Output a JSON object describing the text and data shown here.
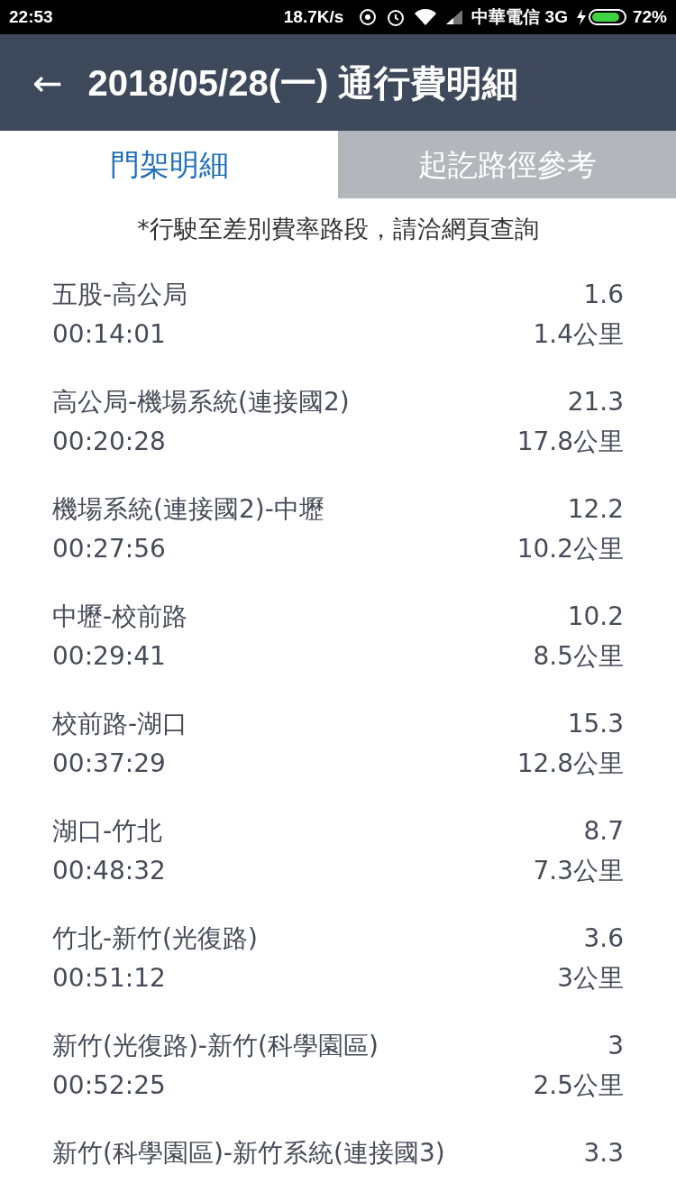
{
  "status_bar": {
    "time": "22:53",
    "speed": "18.7K/s",
    "carrier": "中華電信 3G",
    "battery": "72%"
  },
  "header": {
    "back": "←",
    "title": "2018/05/28(一) 通行費明細"
  },
  "tabs": [
    {
      "label": "門架明細",
      "selected": true
    },
    {
      "label": "起訖路徑參考",
      "selected": false
    }
  ],
  "notice": "*行駛至差別費率路段，請洽網頁查詢",
  "segments": [
    {
      "route": "五股-高公局",
      "amount": "1.6",
      "time": "00:14:01",
      "distance": "1.4公里"
    },
    {
      "route": "高公局-機場系統(連接國2)",
      "amount": "21.3",
      "time": "00:20:28",
      "distance": "17.8公里"
    },
    {
      "route": "機場系統(連接國2)-中壢",
      "amount": "12.2",
      "time": "00:27:56",
      "distance": "10.2公里"
    },
    {
      "route": "中壢-校前路",
      "amount": "10.2",
      "time": "00:29:41",
      "distance": "8.5公里"
    },
    {
      "route": "校前路-湖口",
      "amount": "15.3",
      "time": "00:37:29",
      "distance": "12.8公里"
    },
    {
      "route": "湖口-竹北",
      "amount": "8.7",
      "time": "00:48:32",
      "distance": "7.3公里"
    },
    {
      "route": "竹北-新竹(光復路)",
      "amount": "3.6",
      "time": "00:51:12",
      "distance": "3公里"
    },
    {
      "route": "新竹(光復路)-新竹(科學園區)",
      "amount": "3",
      "time": "00:52:25",
      "distance": "2.5公里"
    },
    {
      "route": "新竹(科學園區)-新竹系統(連接國3)",
      "amount": "3.3"
    }
  ]
}
